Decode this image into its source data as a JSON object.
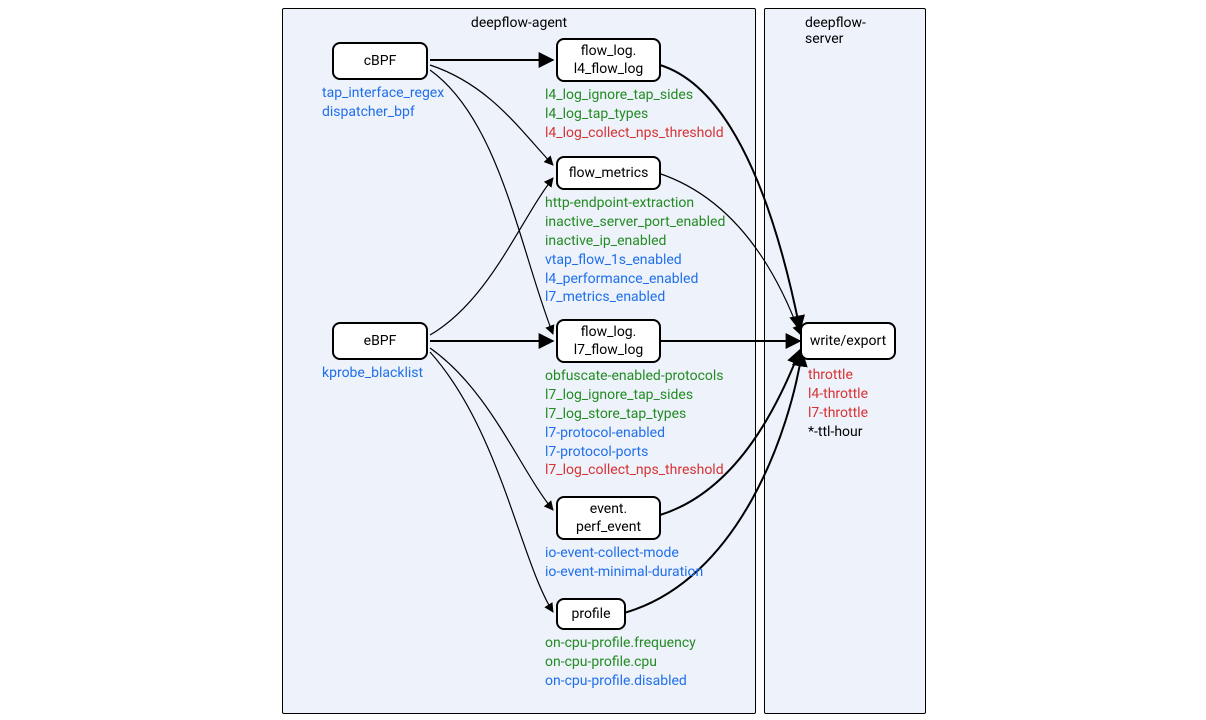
{
  "panels": {
    "agent": {
      "title": "deepflow-agent"
    },
    "server": {
      "title": "deepflow-server"
    }
  },
  "nodes": {
    "cbpf": "cBPF",
    "ebpf": "eBPF",
    "l4": "flow_log.\nl4_flow_log",
    "metrics": "flow_metrics",
    "l7": "flow_log.\nl7_flow_log",
    "event": "event.\nperf_event",
    "profile": "profile",
    "write": "write/export"
  },
  "labels": {
    "cbpf": [
      {
        "text": "tap_interface_regex",
        "cls": "blue"
      },
      {
        "text": "dispatcher_bpf",
        "cls": "blue"
      }
    ],
    "ebpf": [
      {
        "text": "kprobe_blacklist",
        "cls": "blue"
      }
    ],
    "l4": [
      {
        "text": "l4_log_ignore_tap_sides",
        "cls": "green"
      },
      {
        "text": "l4_log_tap_types",
        "cls": "green"
      },
      {
        "text": "l4_log_collect_nps_threshold",
        "cls": "red"
      }
    ],
    "metrics": [
      {
        "text": "http-endpoint-extraction",
        "cls": "green"
      },
      {
        "text": "inactive_server_port_enabled",
        "cls": "green"
      },
      {
        "text": "inactive_ip_enabled",
        "cls": "green"
      },
      {
        "text": "vtap_flow_1s_enabled",
        "cls": "blue"
      },
      {
        "text": "l4_performance_enabled",
        "cls": "blue"
      },
      {
        "text": "l7_metrics_enabled",
        "cls": "blue"
      }
    ],
    "l7": [
      {
        "text": "obfuscate-enabled-protocols",
        "cls": "green"
      },
      {
        "text": "l7_log_ignore_tap_sides",
        "cls": "green"
      },
      {
        "text": "l7_log_store_tap_types",
        "cls": "green"
      },
      {
        "text": "l7-protocol-enabled",
        "cls": "blue"
      },
      {
        "text": "l7-protocol-ports",
        "cls": "blue"
      },
      {
        "text": "l7_log_collect_nps_threshold",
        "cls": "red"
      }
    ],
    "event": [
      {
        "text": "io-event-collect-mode",
        "cls": "blue"
      },
      {
        "text": "io-event-minimal-duration",
        "cls": "blue"
      }
    ],
    "profile": [
      {
        "text": "on-cpu-profile.frequency",
        "cls": "green"
      },
      {
        "text": "on-cpu-profile.cpu",
        "cls": "green"
      },
      {
        "text": "on-cpu-profile.disabled",
        "cls": "blue"
      }
    ],
    "write": [
      {
        "text": "throttle",
        "cls": "red"
      },
      {
        "text": "l4-throttle",
        "cls": "red"
      },
      {
        "text": "l7-throttle",
        "cls": "red"
      },
      {
        "text": "*-ttl-hour",
        "cls": "black"
      }
    ]
  }
}
